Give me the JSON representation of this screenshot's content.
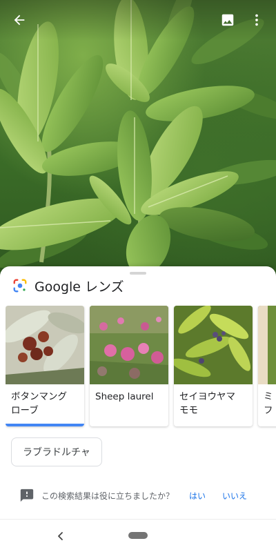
{
  "app": {
    "title": "Google レンズ",
    "accent_color": "#4285f4"
  },
  "top_bar": {
    "back_icon": "arrow-back-icon",
    "image_icon": "image-icon",
    "more_icon": "more-vert-icon"
  },
  "results": [
    {
      "label": "ボタンマング\nローブ",
      "selected": true
    },
    {
      "label": "Sheep laurel",
      "selected": false
    },
    {
      "label": "セイヨウヤマ\nモモ",
      "selected": false
    },
    {
      "label": "ミ\nフ",
      "selected": false
    }
  ],
  "chip": {
    "label": "ラブラドルチャ"
  },
  "feedback": {
    "icon": "feedback-icon",
    "question": "この検索結果は役に立ちましたか？",
    "yes": "はい",
    "no": "いいえ",
    "link_color": "#1a73e8"
  },
  "navbar": {
    "back_icon": "nav-back-icon",
    "home_icon": "home-pill-icon"
  }
}
